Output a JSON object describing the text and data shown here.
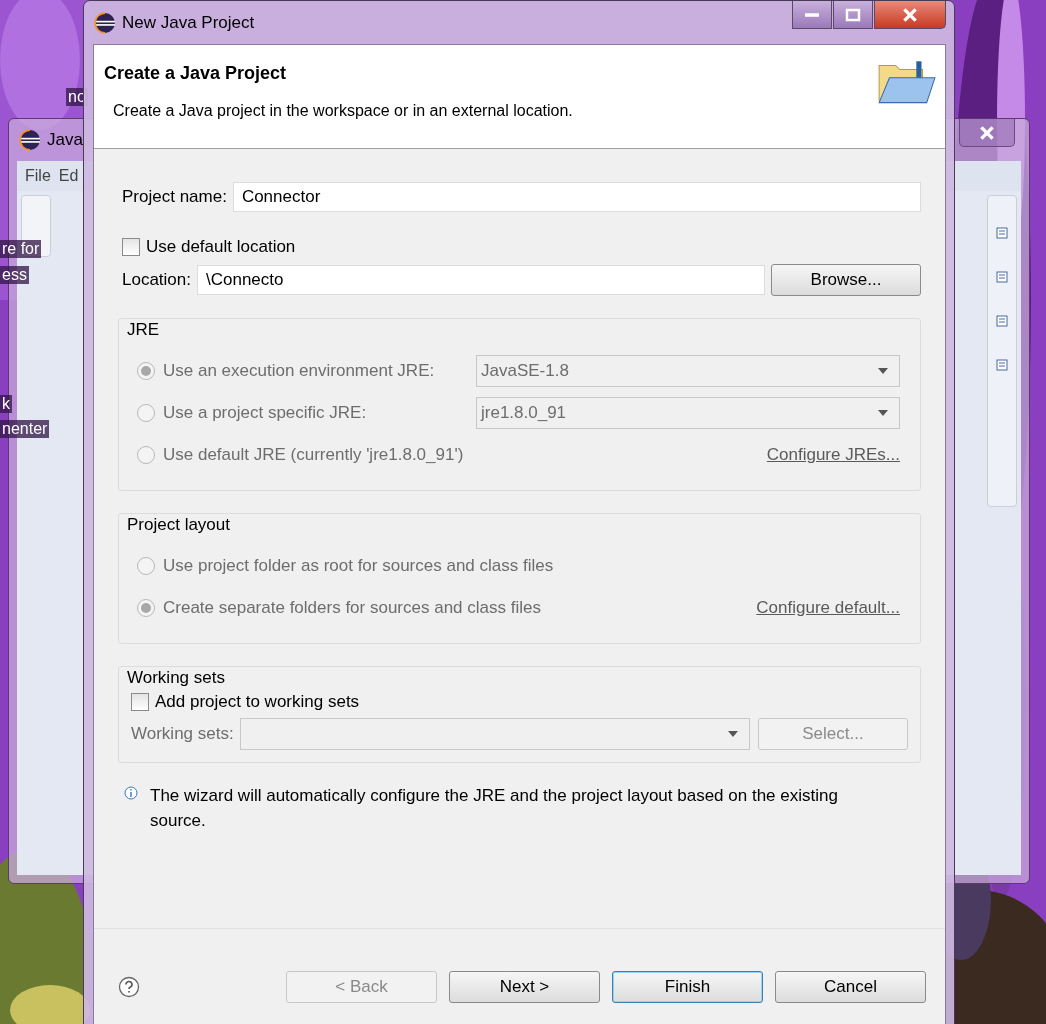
{
  "window": {
    "title": "New Java Project"
  },
  "header": {
    "title": "Create a Java Project",
    "description": "Create a Java project in the workspace or in an external location."
  },
  "project_name": {
    "label": "Project name:",
    "value": "Connector"
  },
  "use_default_location": {
    "label": "Use default location",
    "checked": false
  },
  "location": {
    "label": "Location:",
    "value": "\\Connecto",
    "button": "Browse..."
  },
  "jre": {
    "title": "JRE",
    "disabled": true,
    "options": [
      {
        "label": "Use an execution environment JRE:",
        "selected": true,
        "kind": "combo",
        "value": "JavaSE-1.8"
      },
      {
        "label": "Use a project specific JRE:",
        "selected": false,
        "kind": "combo",
        "value": "jre1.8.0_91"
      },
      {
        "label": "Use default JRE (currently 'jre1.8.0_91')",
        "selected": false,
        "kind": "link",
        "value": "Configure JREs..."
      }
    ]
  },
  "project_layout": {
    "title": "Project layout",
    "disabled": true,
    "options": [
      {
        "label": "Use project folder as root for sources and class files",
        "selected": false,
        "kind": "plain"
      },
      {
        "label": "Create separate folders for sources and class files",
        "selected": true,
        "kind": "link",
        "value": "Configure default..."
      }
    ]
  },
  "working_sets": {
    "title": "Working sets",
    "checkbox": {
      "label": "Add project to working sets",
      "checked": false
    },
    "field_label": "Working sets:",
    "button": "Select...",
    "disabled": true
  },
  "info": "The wizard will automatically configure the JRE and the project layout based on the existing source.",
  "buttons": [
    {
      "label": "< Back",
      "disabled": true,
      "default": false
    },
    {
      "label": "Next >",
      "disabled": false,
      "default": false
    },
    {
      "label": "Finish",
      "disabled": false,
      "default": true
    },
    {
      "label": "Cancel",
      "disabled": false,
      "default": false
    }
  ],
  "background_window": {
    "title": "Java",
    "menu": [
      "File",
      "Ed"
    ]
  },
  "desktop_labels": [
    "no",
    "re for",
    "ess",
    "k",
    "nenter"
  ]
}
